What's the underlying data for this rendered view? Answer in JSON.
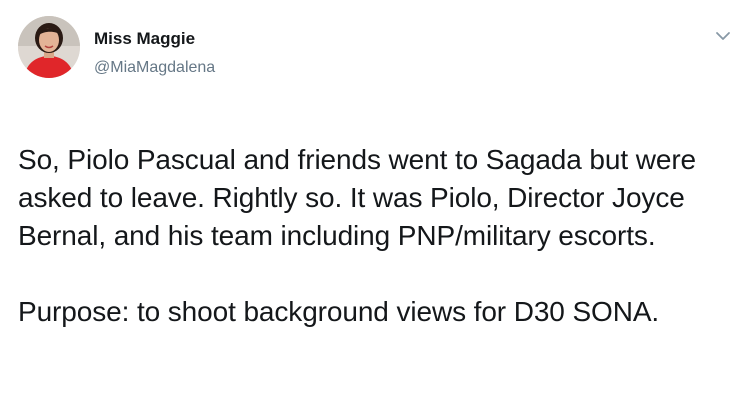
{
  "tweet": {
    "author": {
      "display_name": "Miss Maggie",
      "handle": "@MiaMagdalena",
      "avatar_icon": "user-avatar"
    },
    "menu_icon": "chevron-down-icon",
    "paragraphs": [
      "So, Piolo Pascual and friends went to Sagada but were\nasked to leave. Rightly so. It was Piolo, Director Joyce\nBernal, and his team including PNP/military escorts.",
      "Purpose: to shoot background views for D30 SONA."
    ]
  },
  "colors": {
    "text": "#14171a",
    "secondary_text": "#657786",
    "avatar_shirt": "#e0262a"
  }
}
